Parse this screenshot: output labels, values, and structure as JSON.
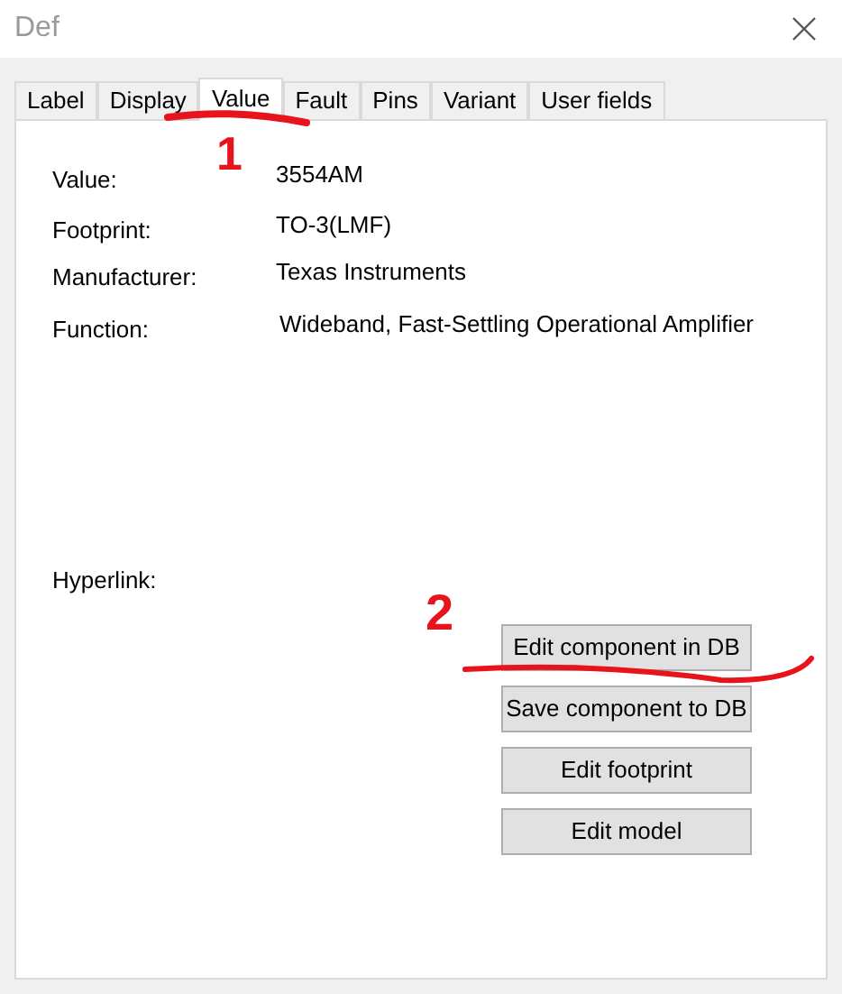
{
  "window": {
    "title": "Def"
  },
  "tabs": [
    {
      "label": "Label",
      "selected": false
    },
    {
      "label": "Display",
      "selected": false
    },
    {
      "label": "Value",
      "selected": true
    },
    {
      "label": "Fault",
      "selected": false
    },
    {
      "label": "Pins",
      "selected": false
    },
    {
      "label": "Variant",
      "selected": false
    },
    {
      "label": "User fields",
      "selected": false
    }
  ],
  "fields": [
    {
      "label": "Value:",
      "value": "3554AM"
    },
    {
      "label": "Footprint:",
      "value": "TO-3(LMF)"
    },
    {
      "label": "Manufacturer:",
      "value": "Texas Instruments"
    },
    {
      "label": "Function:",
      "value": "Wideband, Fast-Settling Operational Amplifier"
    }
  ],
  "hyperlink": {
    "label": "Hyperlink:"
  },
  "buttons": [
    "Edit component in DB",
    "Save component to DB",
    "Edit footprint",
    "Edit model"
  ],
  "annotations": [
    {
      "label": "1"
    },
    {
      "label": "2"
    }
  ]
}
